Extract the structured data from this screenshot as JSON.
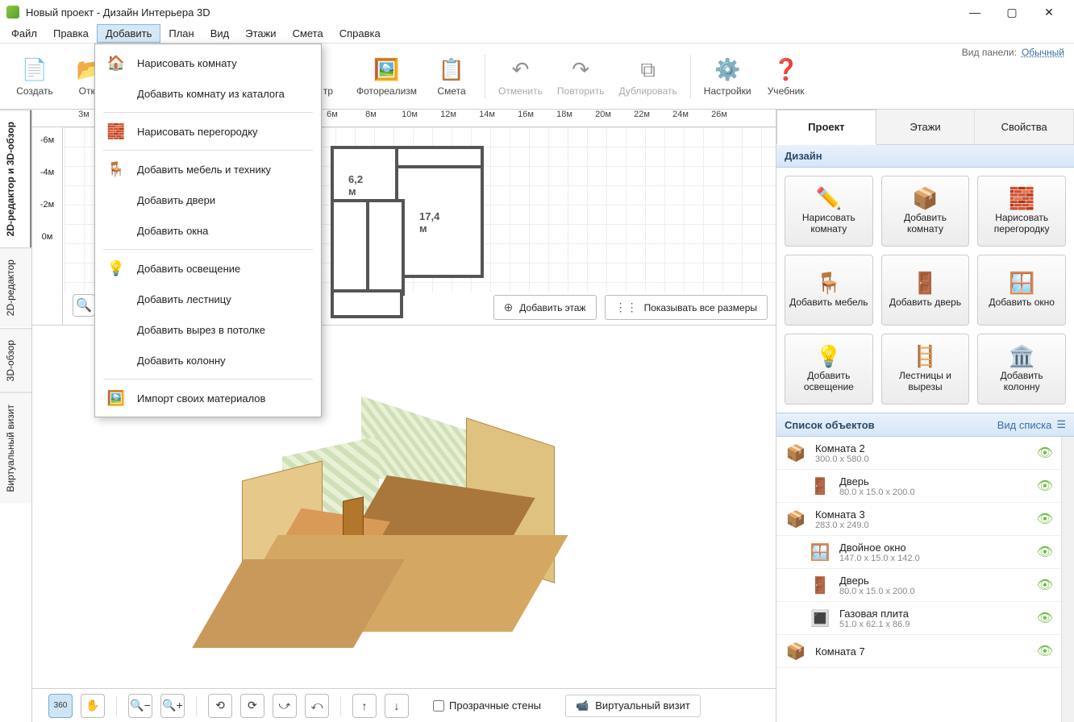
{
  "window": {
    "title": "Новый проект - Дизайн Интерьера 3D"
  },
  "menubar": {
    "file": "Файл",
    "edit": "Правка",
    "add": "Добавить",
    "plan": "План",
    "view": "Вид",
    "floors": "Этажи",
    "estimate": "Смета",
    "help": "Справка"
  },
  "toolbar": {
    "create": "Создать",
    "open": "Откр",
    "fotorealism": "Фотореализм",
    "estimate": "Смета",
    "undo": "Отменить",
    "redo": "Повторить",
    "duplicate": "Дублировать",
    "settings": "Настройки",
    "tutorial": "Учебник",
    "panel_mode_label": "Вид панели:",
    "panel_mode_value": "Обычный",
    "hidden_suffix": "тр"
  },
  "vtabs": {
    "editor3d": "2D-редактор и 3D-обзор",
    "editor2d": "2D-редактор",
    "view3d": "3D-обзор",
    "virtual": "Виртуальный визит"
  },
  "ruler": {
    "top": [
      "3м",
      "6м",
      "8м",
      "10м",
      "12м",
      "14м",
      "16м",
      "18м",
      "20м",
      "22м",
      "24м",
      "26м"
    ],
    "left": [
      "-6м",
      "-4м",
      "-2м",
      "0м"
    ]
  },
  "floorplan": {
    "label_a": "6,2 м",
    "label_b": "17,4 м"
  },
  "plan_buttons": {
    "add_floor": "Добавить этаж",
    "show_dims": "Показывать все размеры"
  },
  "bottom": {
    "transparent_walls": "Прозрачные стены",
    "virtual_visit": "Виртуальный визит",
    "r360": "360"
  },
  "right": {
    "tabs": {
      "project": "Проект",
      "floors": "Этажи",
      "props": "Свойства"
    },
    "design_header": "Дизайн",
    "buttons": {
      "draw_room": "Нарисовать комнату",
      "add_room": "Добавить комнату",
      "draw_partition": "Нарисовать перегородку",
      "add_furn": "Добавить мебель",
      "add_door": "Добавить дверь",
      "add_window": "Добавить окно",
      "add_light": "Добавить освещение",
      "stairs": "Лестницы и вырезы",
      "add_column": "Добавить колонну"
    },
    "objects_header": "Список объектов",
    "view_mode": "Вид списка",
    "objects": [
      {
        "type": "room",
        "name": "Комната 2",
        "dims": "300.0 x 580.0"
      },
      {
        "type": "door",
        "name": "Дверь",
        "dims": "80.0 x 15.0 x 200.0",
        "child": true
      },
      {
        "type": "room",
        "name": "Комната 3",
        "dims": "283.0 x 249.0"
      },
      {
        "type": "window",
        "name": "Двойное окно",
        "dims": "147.0 x 15.0 x 142.0",
        "child": true
      },
      {
        "type": "door",
        "name": "Дверь",
        "dims": "80.0 x 15.0 x 200.0",
        "child": true
      },
      {
        "type": "stove",
        "name": "Газовая плита",
        "dims": "51.0 x 62.1 x 86.9",
        "child": true
      },
      {
        "type": "room",
        "name": "Комната 7",
        "dims": ""
      }
    ]
  },
  "dropdown": {
    "draw_room": "Нарисовать комнату",
    "add_room_catalog": "Добавить комнату из каталога",
    "draw_partition": "Нарисовать перегородку",
    "add_furniture": "Добавить мебель и технику",
    "add_doors": "Добавить двери",
    "add_windows": "Добавить окна",
    "add_lighting": "Добавить освещение",
    "add_stairs": "Добавить лестницу",
    "add_ceiling_cut": "Добавить вырез в потолке",
    "add_column": "Добавить колонну",
    "import_materials": "Импорт своих материалов"
  }
}
